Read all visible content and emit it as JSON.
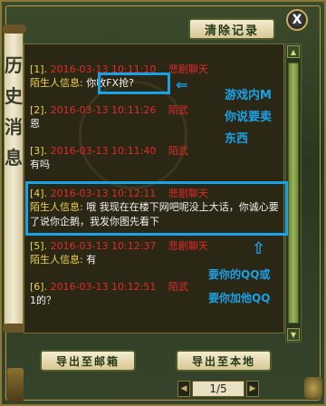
{
  "window": {
    "side_title_chars": [
      "历",
      "史",
      "消",
      "息"
    ],
    "close_label": "X",
    "clear_button": "清除记录"
  },
  "entries": [
    {
      "index": "[1].",
      "date": "2016-03-13 10:11:10",
      "kind": "悲剧聊天",
      "sender": "陌生人信息:",
      "message": "你收FX抢?"
    },
    {
      "index": "[2].",
      "date": "2016-03-13 10:11:26",
      "kind": "陌武",
      "sender": "",
      "message": "恩"
    },
    {
      "index": "[3].",
      "date": "2016-03-13 10:11:40",
      "kind": "陌武",
      "sender": "",
      "message": "有吗"
    },
    {
      "index": "[4].",
      "date": "2016-03-13 10:12:11",
      "kind": "悲剧聊天",
      "sender": "陌生人信息:",
      "message": "哦  我现在在楼下网吧呢没上大话，你诚心要了说你企鹅，我发你图先看下"
    },
    {
      "index": "[5].",
      "date": "2016-03-13 10:12:37",
      "kind": "悲剧聊天",
      "sender": "陌生人信息:",
      "message": "有"
    },
    {
      "index": "[6].",
      "date": "2016-03-13 10:12:51",
      "kind": "陌武",
      "sender": "",
      "message": "1的？"
    }
  ],
  "annotations": {
    "note1": "游戏内M你说要卖东西",
    "note2_line1": "要你的QQ或",
    "note2_line2": "要你加他QQ",
    "arrow_left": "⇐",
    "arrow_up": "⇧"
  },
  "buttons": {
    "export_mail": "导出至邮箱",
    "export_local": "导出至本地"
  },
  "pager": {
    "prev_icon": "◀",
    "next_icon": "▶",
    "page": "1/5"
  },
  "colors": {
    "highlight": "#1aa2e8",
    "date_red": "#e02a2a",
    "index_yellow": "#f0d24a"
  }
}
